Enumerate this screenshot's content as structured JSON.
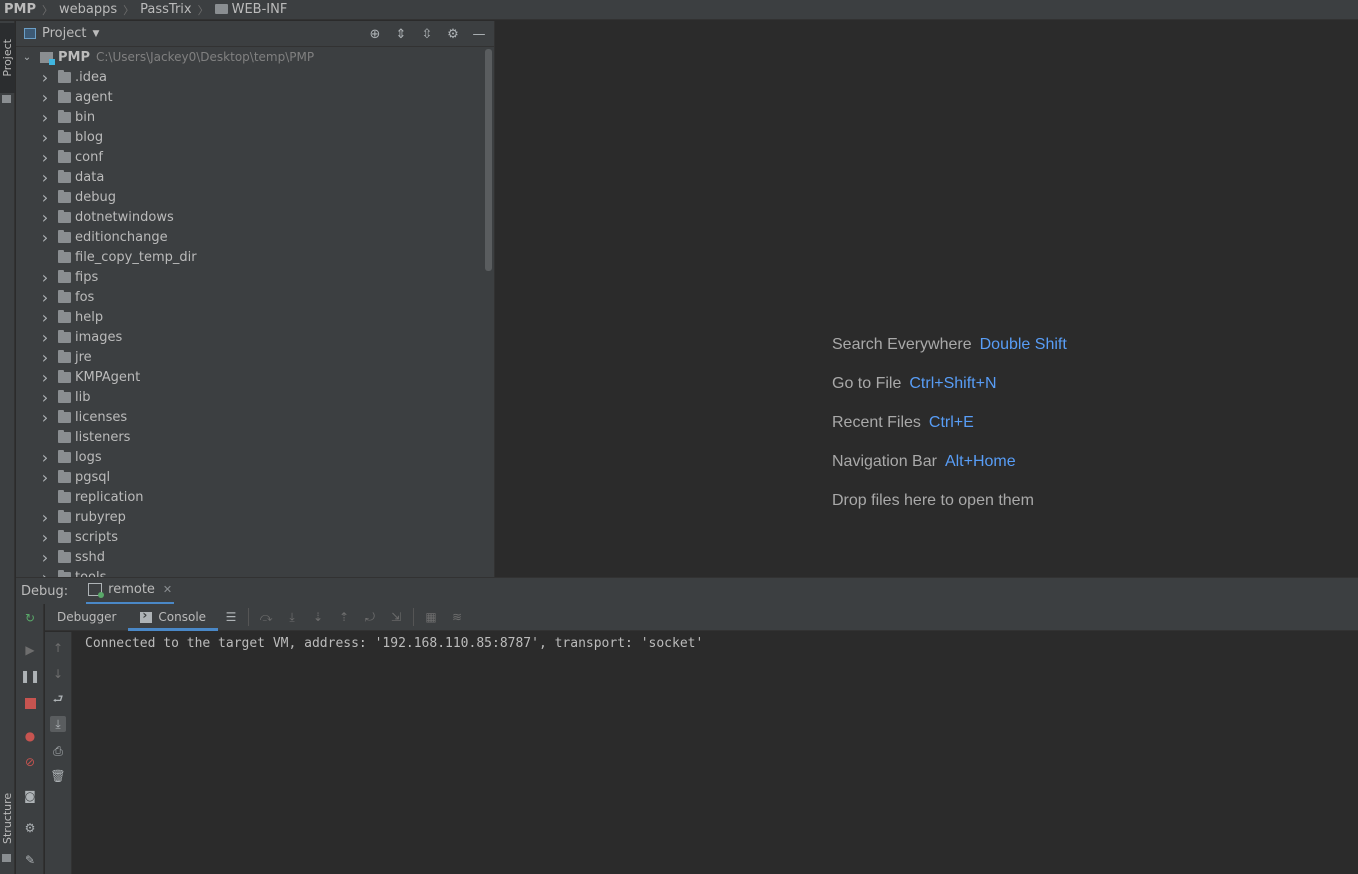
{
  "breadcrumb": [
    "PMP",
    "webapps",
    "PassTrix",
    "WEB-INF"
  ],
  "stripe": {
    "project_label": "Project",
    "structure_label": "Structure"
  },
  "project_panel": {
    "title": "Project",
    "root": {
      "name": "PMP",
      "path": "C:\\Users\\Jackey0\\Desktop\\temp\\PMP"
    },
    "items": [
      {
        "label": ".idea",
        "expandable": true
      },
      {
        "label": "agent",
        "expandable": true
      },
      {
        "label": "bin",
        "expandable": true
      },
      {
        "label": "blog",
        "expandable": true
      },
      {
        "label": "conf",
        "expandable": true
      },
      {
        "label": "data",
        "expandable": true
      },
      {
        "label": "debug",
        "expandable": true
      },
      {
        "label": "dotnetwindows",
        "expandable": true
      },
      {
        "label": "editionchange",
        "expandable": true
      },
      {
        "label": "file_copy_temp_dir",
        "expandable": false
      },
      {
        "label": "fips",
        "expandable": true
      },
      {
        "label": "fos",
        "expandable": true
      },
      {
        "label": "help",
        "expandable": true
      },
      {
        "label": "images",
        "expandable": true
      },
      {
        "label": "jre",
        "expandable": true
      },
      {
        "label": "KMPAgent",
        "expandable": true
      },
      {
        "label": "lib",
        "expandable": true
      },
      {
        "label": "licenses",
        "expandable": true
      },
      {
        "label": "listeners",
        "expandable": false
      },
      {
        "label": "logs",
        "expandable": true
      },
      {
        "label": "pgsql",
        "expandable": true
      },
      {
        "label": "replication",
        "expandable": false
      },
      {
        "label": "rubyrep",
        "expandable": true
      },
      {
        "label": "scripts",
        "expandable": true
      },
      {
        "label": "sshd",
        "expandable": true
      },
      {
        "label": "tools",
        "expandable": true
      }
    ]
  },
  "editor_hints": [
    {
      "label": "Search Everywhere",
      "key": "Double Shift"
    },
    {
      "label": "Go to File",
      "key": "Ctrl+Shift+N"
    },
    {
      "label": "Recent Files",
      "key": "Ctrl+E"
    },
    {
      "label": "Navigation Bar",
      "key": "Alt+Home"
    },
    {
      "label": "Drop files here to open them",
      "key": ""
    }
  ],
  "debug": {
    "label": "Debug:",
    "session_tab": "remote",
    "subtabs": [
      "Debugger",
      "Console"
    ],
    "console_text": "Connected to the target VM, address: '192.168.110.85:8787', transport: 'socket'"
  }
}
